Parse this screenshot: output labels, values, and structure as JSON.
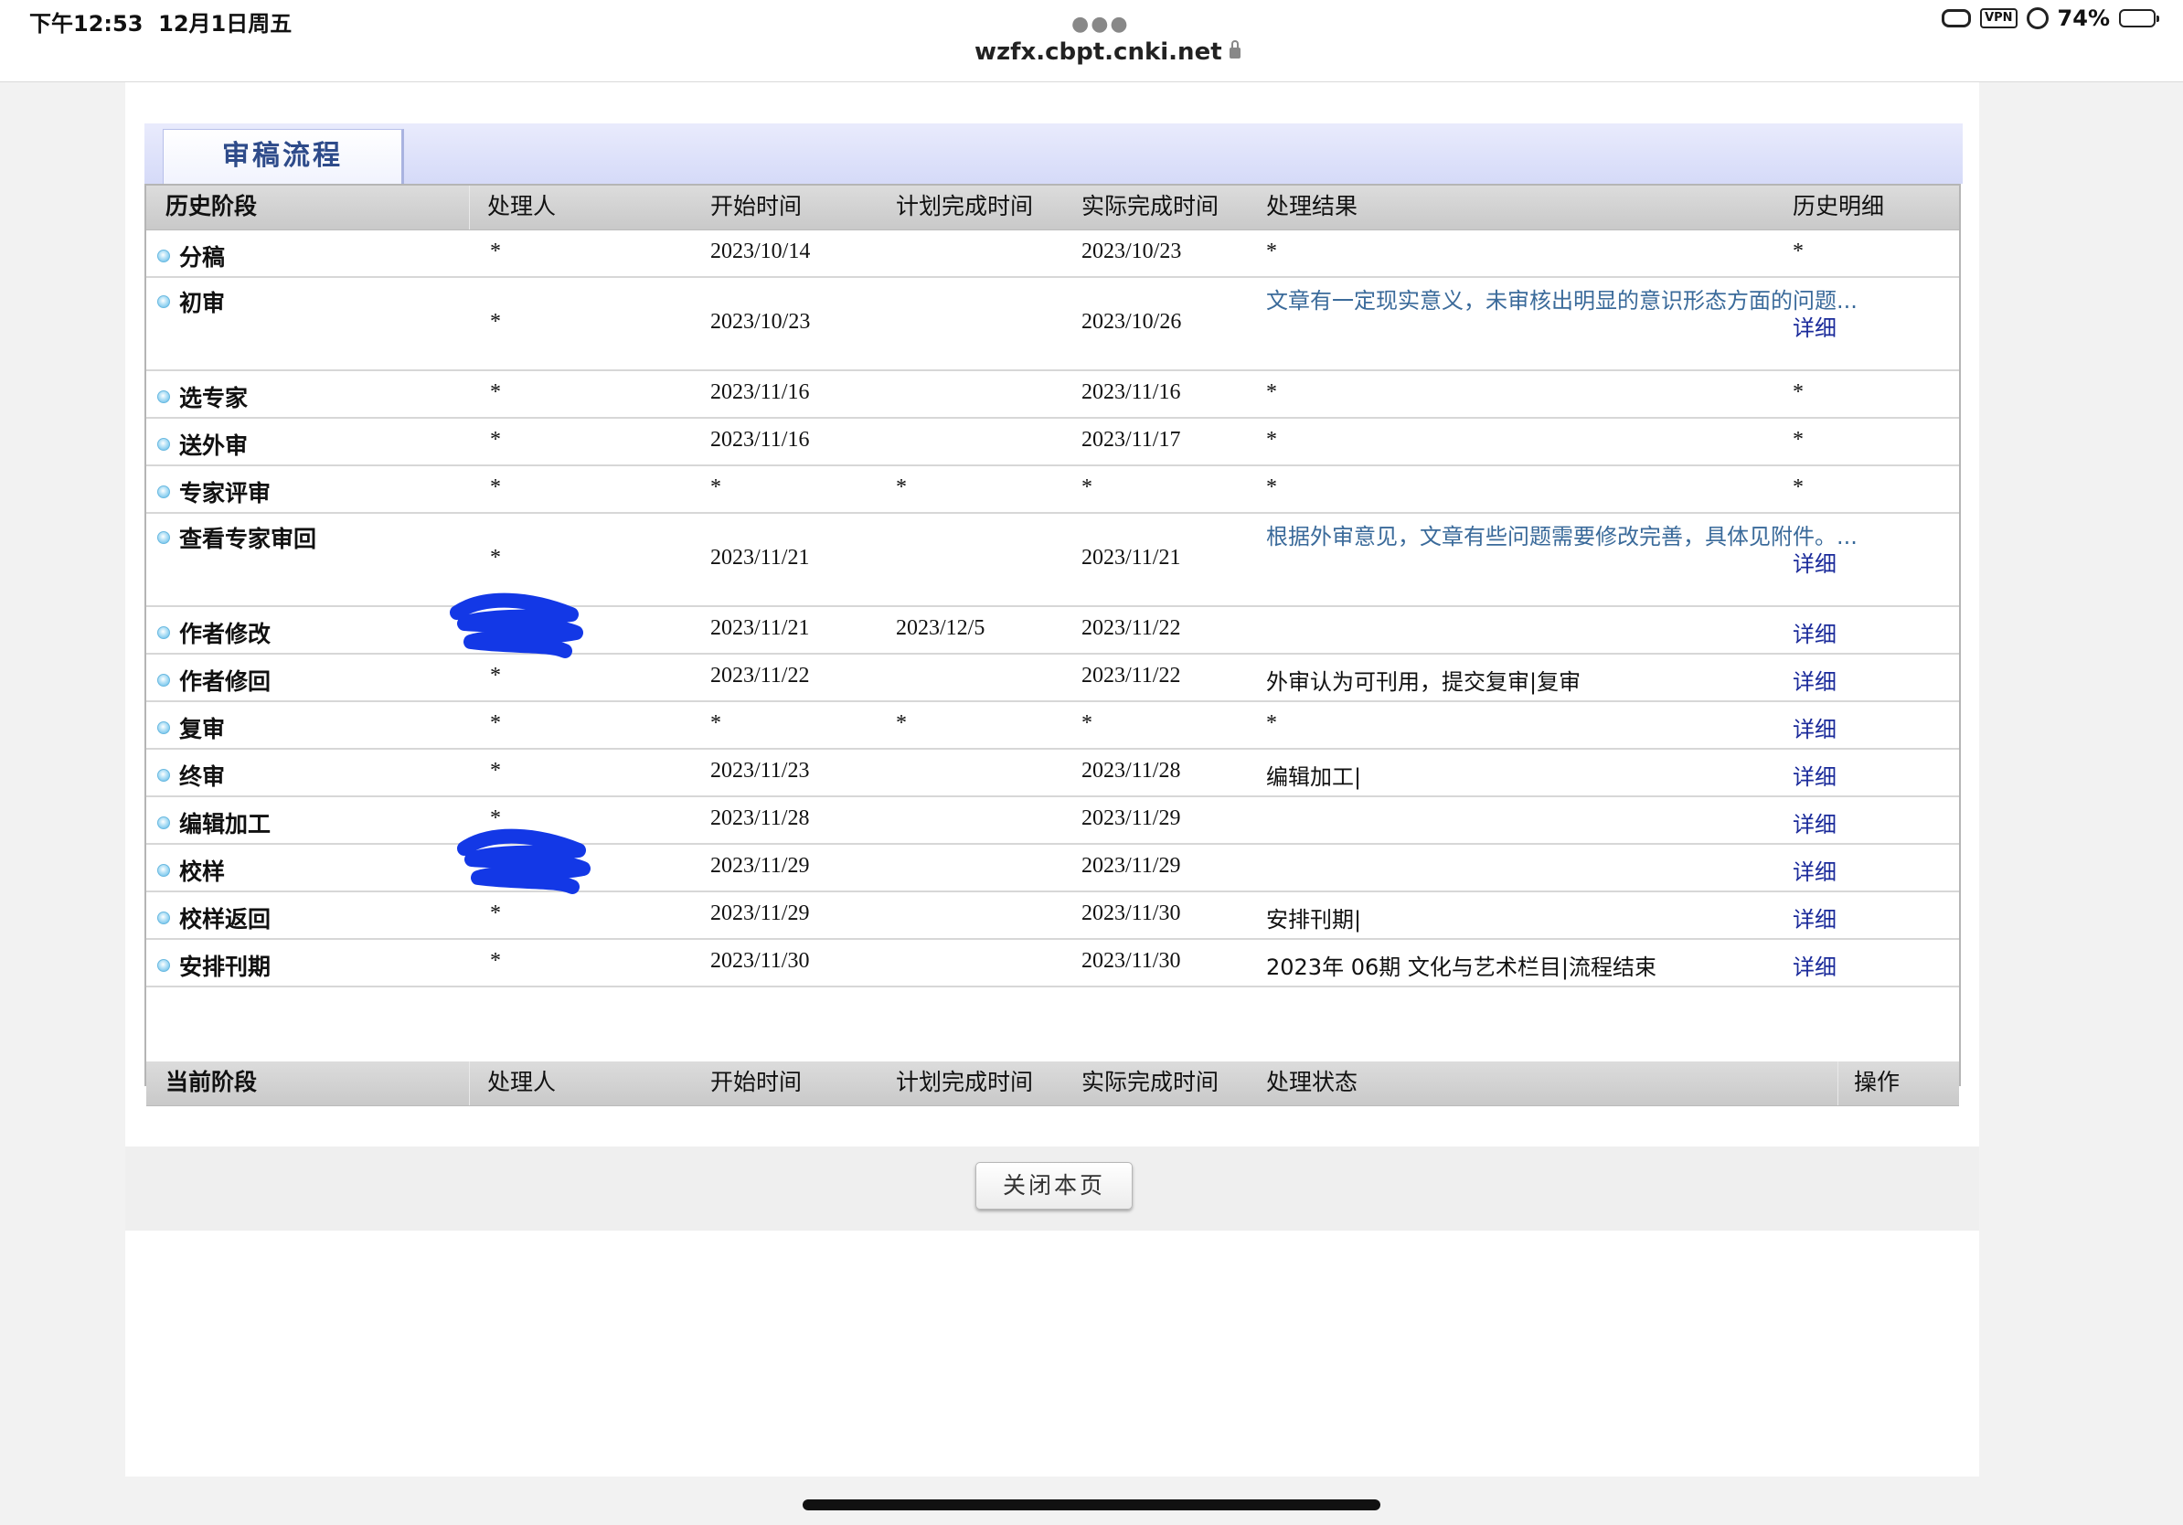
{
  "status_bar": {
    "time": "下午12:53",
    "date": "12月1日周五",
    "url": "wzfx.cbpt.cnki.net",
    "vpn": "VPN",
    "battery": "74%",
    "battery_level": 0.74
  },
  "panel": {
    "title": "审稿流程"
  },
  "history": {
    "headers": {
      "stage": "历史阶段",
      "handler": "处理人",
      "start": "开始时间",
      "planned": "计划完成时间",
      "actual": "实际完成时间",
      "result": "处理结果",
      "detail": "历史明细"
    },
    "rows": [
      {
        "stage": "分稿",
        "handler": "*",
        "start": "2023/10/14",
        "planned": "",
        "actual": "2023/10/23",
        "result": "*",
        "detail": "*"
      },
      {
        "stage": "初审",
        "handler": "*",
        "start": "2023/10/23",
        "planned": "",
        "actual": "2023/10/26",
        "result": "文章有一定现实意义，未审核出明显的意识形态方面的问题...",
        "detail": "详细"
      },
      {
        "stage": "选专家",
        "handler": "*",
        "start": "2023/11/16",
        "planned": "",
        "actual": "2023/11/16",
        "result": "*",
        "detail": "*"
      },
      {
        "stage": "送外审",
        "handler": "*",
        "start": "2023/11/16",
        "planned": "",
        "actual": "2023/11/17",
        "result": "*",
        "detail": "*"
      },
      {
        "stage": "专家评审",
        "handler": "*",
        "start": "*",
        "planned": "*",
        "actual": "*",
        "result": "*",
        "detail": "*"
      },
      {
        "stage": "查看专家审回",
        "handler": "*",
        "start": "2023/11/21",
        "planned": "",
        "actual": "2023/11/21",
        "result": "根据外审意见，文章有些问题需要修改完善，具体见附件。...",
        "detail": "详细"
      },
      {
        "stage": "作者修改",
        "handler": "",
        "start": "2023/11/21",
        "planned": "2023/12/5",
        "actual": "2023/11/22",
        "result": "",
        "detail": "详细"
      },
      {
        "stage": "作者修回",
        "handler": "*",
        "start": "2023/11/22",
        "planned": "",
        "actual": "2023/11/22",
        "result": "外审认为可刊用，提交复审|复审",
        "detail": "详细"
      },
      {
        "stage": "复审",
        "handler": "*",
        "start": "*",
        "planned": "*",
        "actual": "*",
        "result": "*",
        "detail": "详细"
      },
      {
        "stage": "终审",
        "handler": "*",
        "start": "2023/11/23",
        "planned": "",
        "actual": "2023/11/28",
        "result": "编辑加工|",
        "detail": "详细"
      },
      {
        "stage": "编辑加工",
        "handler": "*",
        "start": "2023/11/28",
        "planned": "",
        "actual": "2023/11/29",
        "result": "",
        "detail": "详细"
      },
      {
        "stage": "校样",
        "handler": "",
        "start": "2023/11/29",
        "planned": "",
        "actual": "2023/11/29",
        "result": "",
        "detail": "详细"
      },
      {
        "stage": "校样返回",
        "handler": "*",
        "start": "2023/11/29",
        "planned": "",
        "actual": "2023/11/30",
        "result": "安排刊期|",
        "detail": "详细"
      },
      {
        "stage": "安排刊期",
        "handler": "*",
        "start": "2023/11/30",
        "planned": "",
        "actual": "2023/11/30",
        "result": "2023年 06期 文化与艺术栏目|流程结束",
        "detail": "详细"
      }
    ]
  },
  "current": {
    "headers": {
      "stage": "当前阶段",
      "handler": "处理人",
      "start": "开始时间",
      "planned": "计划完成时间",
      "actual": "实际完成时间",
      "status": "处理状态",
      "action": "操作"
    }
  },
  "close_button": "关闭本页"
}
